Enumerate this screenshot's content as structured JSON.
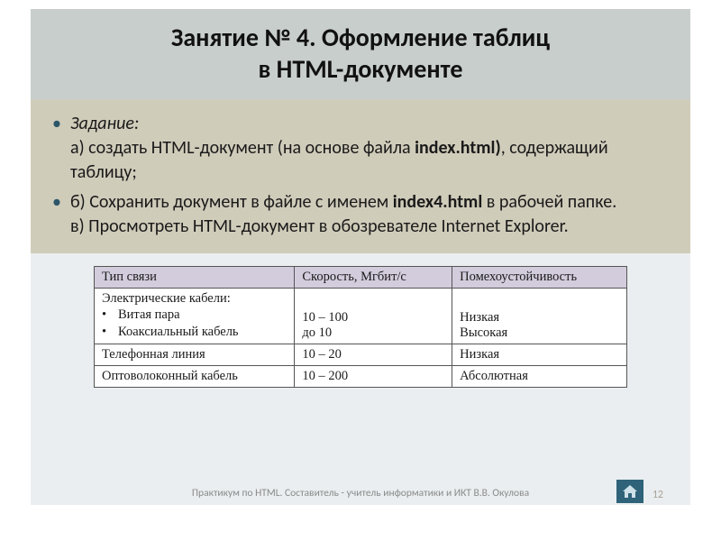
{
  "title_line1": "Занятие № 4. Оформление таблиц",
  "title_line2": "в HTML-документе",
  "bullets": [
    {
      "task_label": "Задание",
      "a_prefix": "а) создать HTML-документ (на основе файла ",
      "a_bold": "index.html)",
      "a_suffix": ", содержащий таблицу;"
    },
    {
      "b_prefix": "б) Сохранить документ в файле с именем ",
      "b_bold": "index4.html",
      "b_suffix": " в рабочей папке.",
      "c_text": "в) Просмотреть HTML-документ в обозревателе Internet Explorer."
    }
  ],
  "table": {
    "headers": [
      "Тип связи",
      "Скорость, Мгбит/с",
      "Помехоустойчивость"
    ],
    "rows": [
      {
        "type_main": "Электрические кабели:",
        "type_items": [
          "Витая пара",
          "Коаксиальный кабель"
        ],
        "speed": "10 – 100\nдо 10",
        "noise": "Низкая\nВысокая"
      },
      {
        "type": "Телефонная линия",
        "speed": "10 – 20",
        "noise": "Низкая"
      },
      {
        "type": "Оптоволоконный кабель",
        "speed": "10 – 200",
        "noise": "Абсолютная"
      }
    ]
  },
  "footer": "Практикум по HTML. Составитель - учитель информатики и ИКТ В.В. Окулова",
  "page": "12"
}
